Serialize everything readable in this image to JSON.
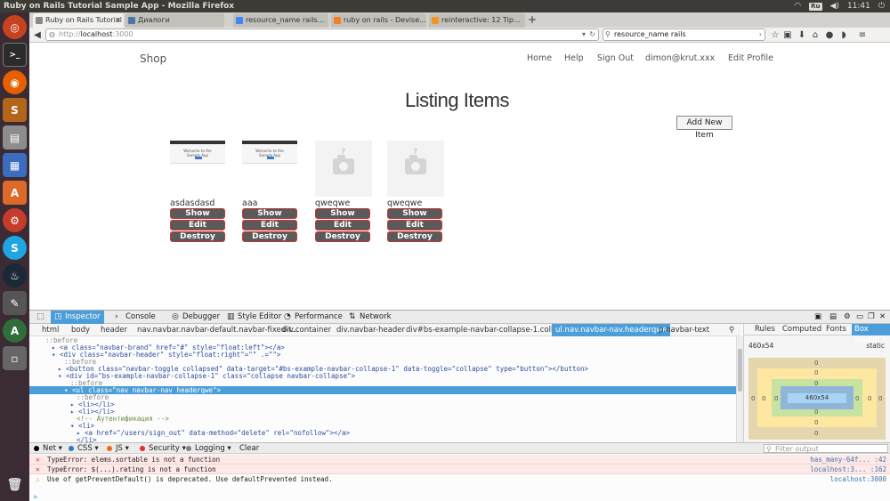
{
  "window": {
    "title": "Ruby on Rails Tutorial Sample App - Mozilla Firefox"
  },
  "tray": {
    "keyboard": "Ru",
    "time": "11:41"
  },
  "tabs": [
    {
      "label": "Ruby on Rails Tutorial S...",
      "active": true
    },
    {
      "label": "Диалоги",
      "active": false
    },
    {
      "label": "resource_name rails...",
      "active": false
    },
    {
      "label": "ruby on rails - Devise...",
      "active": false
    },
    {
      "label": "reinteractive: 12 Tip...",
      "active": false
    }
  ],
  "newtab_label": "+",
  "nav": {
    "url_scheme": "http://",
    "url_host": "localhost",
    "url_port": ":3000",
    "search_value": "resource_name rails"
  },
  "site": {
    "brand": "Shop",
    "links": [
      "Home",
      "Help",
      "Sign Out",
      "dimon@krut.xxx",
      "Edit Profile"
    ],
    "page_title": "Listing Items",
    "add_label": "Add New Item",
    "thumb_caption": "Welcome to the Sample App",
    "qmark": "?",
    "items": [
      {
        "name": "asdasdasd",
        "image": "screenshot"
      },
      {
        "name": "aaa",
        "image": "screenshot"
      },
      {
        "name": "qweqwe",
        "image": "placeholder"
      },
      {
        "name": "qweqwe",
        "image": "placeholder"
      }
    ],
    "actions": {
      "show": "Show",
      "edit": "Edit",
      "destroy": "Destroy"
    }
  },
  "devtools": {
    "tabs": [
      "Inspector",
      "Console",
      "Debugger",
      "Style Editor",
      "Performance",
      "Network"
    ],
    "breadcrumbs": [
      "html",
      "body",
      "header",
      "nav.navbar.navbar-default.navbar-fixed-t...",
      "div.container",
      "div.navbar-header",
      "div#bs-example-navbar-collapse-1.collaps...",
      "ul.nav.navbar-nav.headerqwe",
      "p.navbar-text"
    ],
    "markup": [
      {
        "indent": 2,
        "text": "::before",
        "kind": "pseudo"
      },
      {
        "indent": 3,
        "text": "▸ <a class=\"navbar-brand\" href=\"#\" style=\"float:left\"></a>",
        "kind": "tag"
      },
      {
        "indent": 3,
        "text": "▾ <div class=\"navbar-header\" style=\"float:right\"=\"\" .=\"\">",
        "kind": "tag"
      },
      {
        "indent": 5,
        "text": "::before",
        "kind": "pseudo"
      },
      {
        "indent": 4,
        "text": "▸ <button class=\"navbar-toggle collapsed\" data-target=\"#bs-example-navbar-collapse-1\" data-toggle=\"collapse\" type=\"button\"></button>",
        "kind": "tag"
      },
      {
        "indent": 4,
        "text": "▾ <div id=\"bs-example-navbar-collapse-1\" class=\"collapse navbar-collapse\">",
        "kind": "tag"
      },
      {
        "indent": 6,
        "text": "::before",
        "kind": "pseudo"
      },
      {
        "indent": 5,
        "text": "▾ <ul class=\"nav navbar-nav headerqwe\">",
        "kind": "selected"
      },
      {
        "indent": 7,
        "text": "::before",
        "kind": "pseudo"
      },
      {
        "indent": 6,
        "text": "▸ <li></li>",
        "kind": "tag"
      },
      {
        "indent": 6,
        "text": "▸ <li></li>",
        "kind": "tag"
      },
      {
        "indent": 7,
        "text": "<!-- Аутентификация -->",
        "kind": "comment"
      },
      {
        "indent": 6,
        "text": "▾ <li>",
        "kind": "tag"
      },
      {
        "indent": 7,
        "text": "▸ <a href=\"/users/sign_out\" data-method=\"delete\" rel=\"nofollow\"></a>",
        "kind": "tag"
      },
      {
        "indent": 7,
        "text": "</li>",
        "kind": "tag"
      }
    ],
    "side_tabs": [
      "Rules",
      "Computed",
      "Fonts",
      "Box Model"
    ],
    "box": {
      "dims": "460x54",
      "position": "static",
      "content": "460x54",
      "zero": "0"
    },
    "console_filters": [
      {
        "label": "Net",
        "color": "#000000"
      },
      {
        "label": "CSS",
        "color": "#2e79c7"
      },
      {
        "label": "JS",
        "color": "#e66e1b"
      },
      {
        "label": "Security",
        "color": "#e0302b"
      },
      {
        "label": "Logging",
        "color": "#808080"
      }
    ],
    "clear_label": "Clear",
    "filter_placeholder": "Filter output",
    "messages": [
      {
        "type": "error",
        "text": "TypeError: elems.sortable is not a function",
        "source": "has_many-64f... :42"
      },
      {
        "type": "error",
        "text": "TypeError: $(...).rating is not a function",
        "source": "localhost:3... :162"
      },
      {
        "type": "warn",
        "text": "Use of getPreventDefault() is deprecated.  Use defaultPrevented instead.",
        "source": "localhost:3000"
      }
    ],
    "prompt": "»"
  }
}
